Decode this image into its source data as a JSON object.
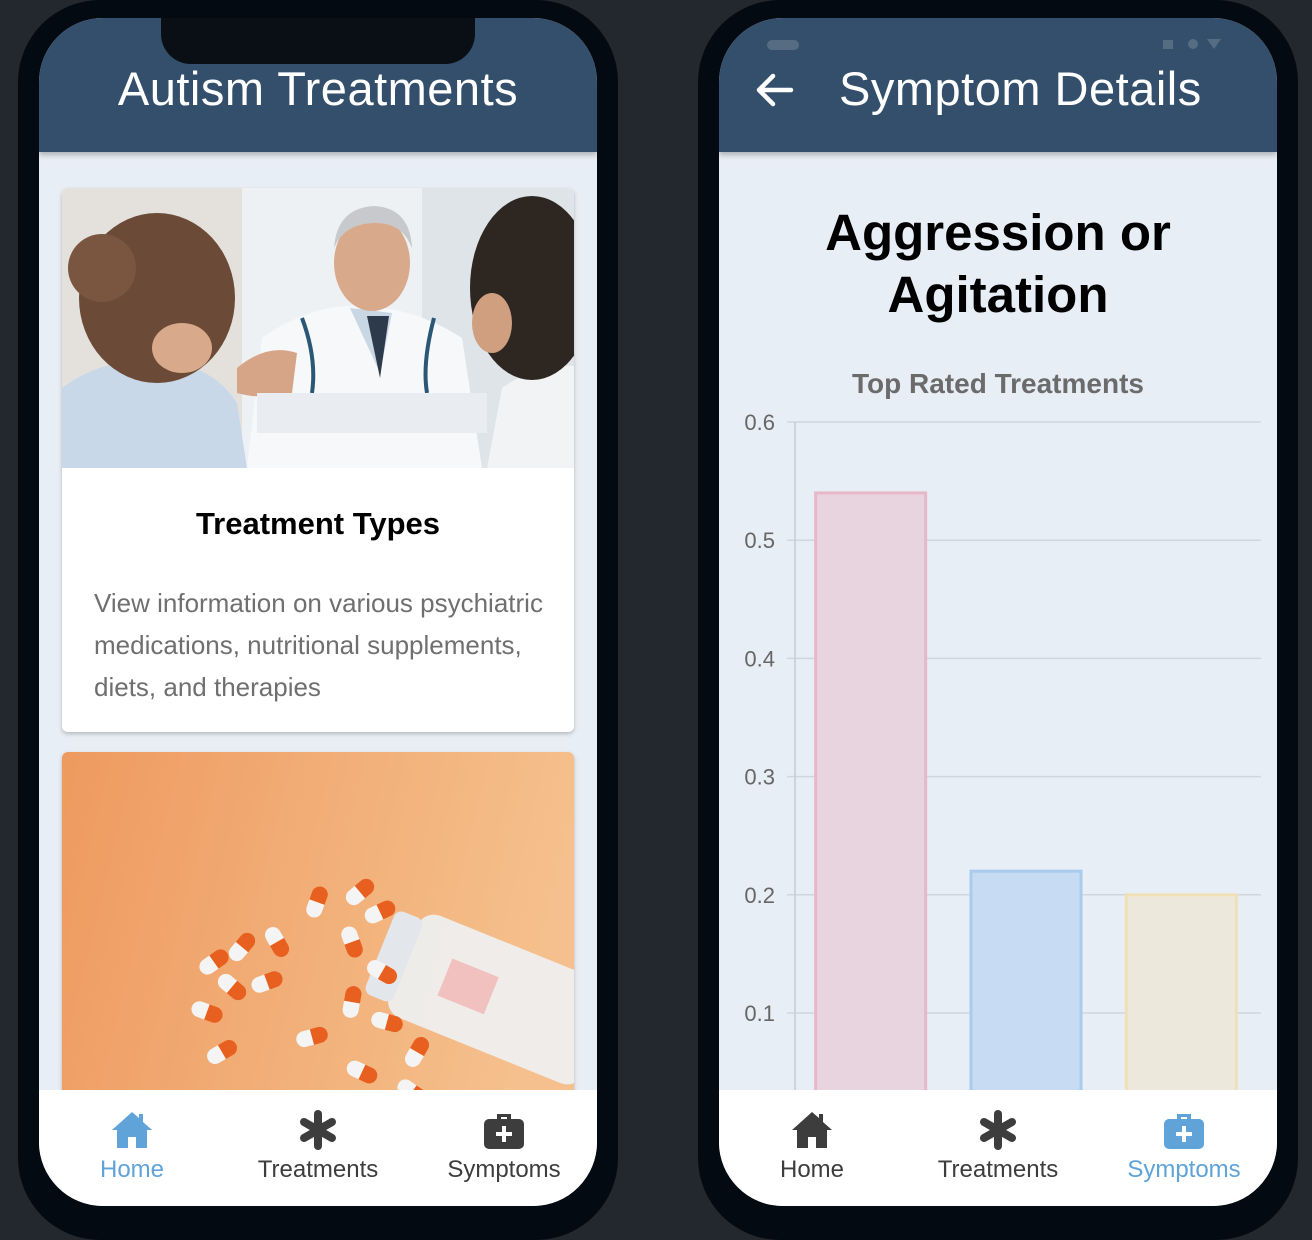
{
  "phone1": {
    "header": {
      "title": "Autism Treatments"
    },
    "cards": [
      {
        "title": "Treatment Types",
        "description": "View information on various psychiatric medications, nutritional supplements, diets, and therapies"
      }
    ],
    "tabbar": {
      "active": "Home",
      "tabs": [
        {
          "label": "Home",
          "icon": "home-icon"
        },
        {
          "label": "Treatments",
          "icon": "asterisk-icon"
        },
        {
          "label": "Symptoms",
          "icon": "medkit-icon"
        }
      ]
    }
  },
  "phone2": {
    "header": {
      "title": "Symptom Details"
    },
    "symptom": {
      "title": "Aggression or Agitation"
    },
    "tabbar": {
      "active": "Symptoms",
      "tabs": [
        {
          "label": "Home",
          "icon": "home-icon"
        },
        {
          "label": "Treatments",
          "icon": "asterisk-icon"
        },
        {
          "label": "Symptoms",
          "icon": "medkit-icon"
        }
      ]
    }
  },
  "colors": {
    "header": "#344f6c",
    "background": "#e8eef5",
    "active_tab": "#5fa3d8",
    "bar1": "#e8d4de",
    "bar2": "#c7dcf2",
    "bar3": "#ede8dc"
  },
  "chart_data": {
    "type": "bar",
    "title": "Top Rated Treatments",
    "categories": [
      "",
      "",
      ""
    ],
    "values": [
      0.54,
      0.22,
      0.2
    ],
    "yticks": [
      "0.6",
      "0.5",
      "0.4",
      "0.3",
      "0.2",
      "0.1"
    ],
    "ylim": [
      0,
      0.6
    ],
    "grid": true,
    "bar_fill": [
      "#e8d4de",
      "#c7dcf2",
      "#ede8dc"
    ],
    "bar_border": [
      "#e6b8c8",
      "#a8cbee",
      "#efe0b8"
    ]
  }
}
